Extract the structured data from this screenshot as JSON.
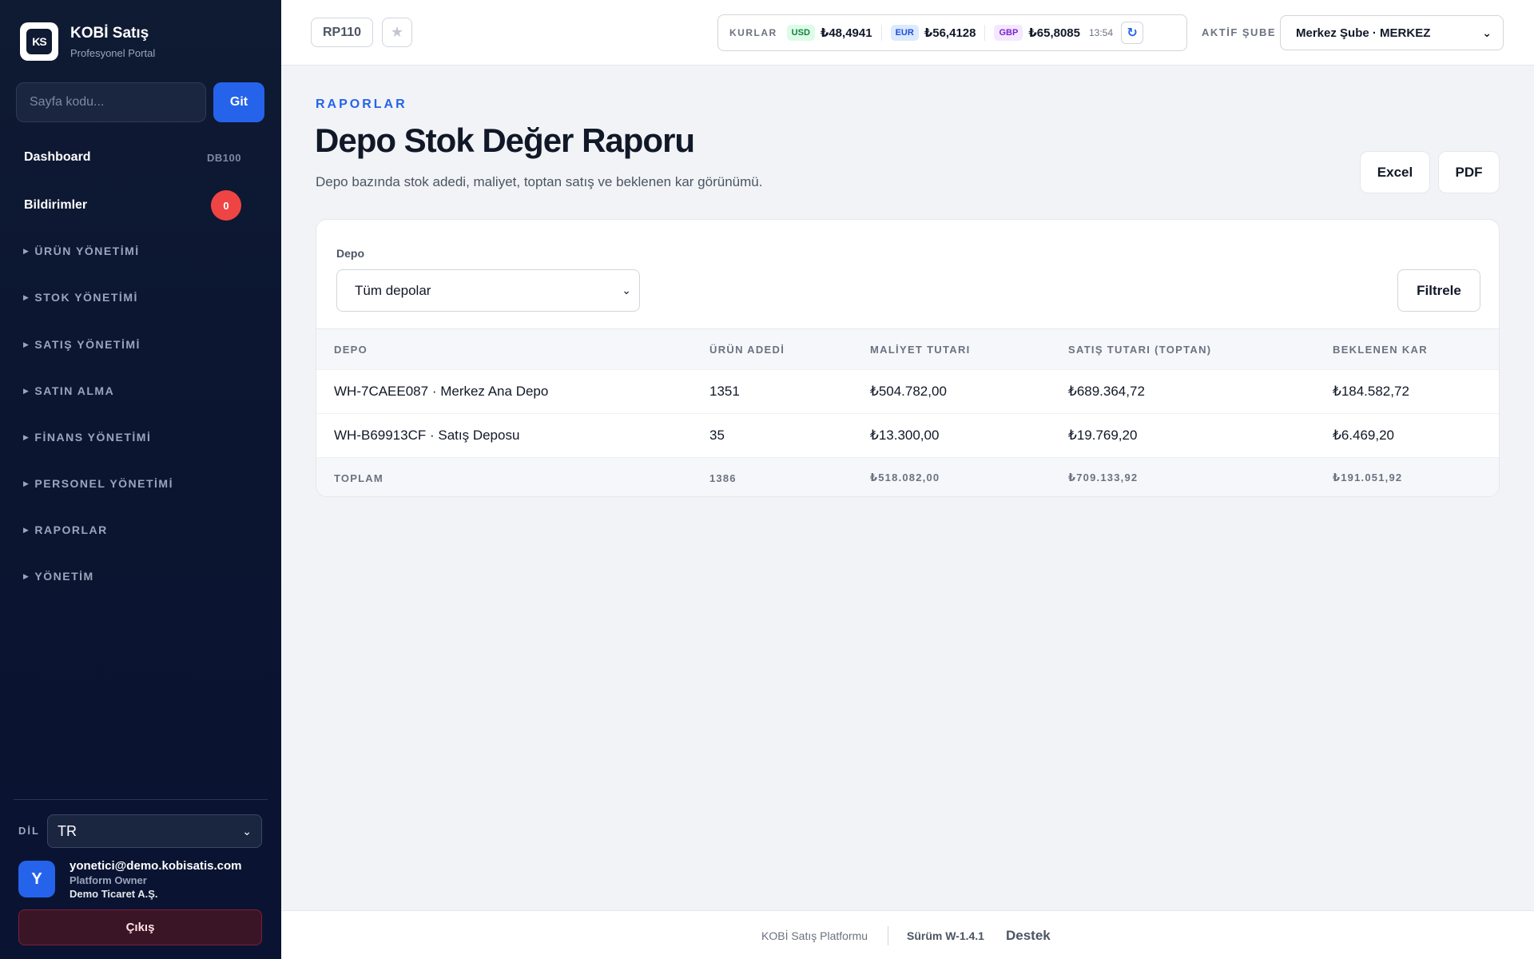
{
  "sidebar": {
    "brand_title": "KOBİ Satış",
    "brand_subtitle": "Profesyonel Portal",
    "logo_text": "KS",
    "search_placeholder": "Sayfa kodu...",
    "go_label": "Git",
    "dashboard_label": "Dashboard",
    "dashboard_code": "DB100",
    "notifications_label": "Bildirimler",
    "notifications_count": "0",
    "groups": [
      "ÜRÜN YÖNETİMİ",
      "STOK YÖNETİMİ",
      "SATIŞ YÖNETİMİ",
      "SATIN ALMA",
      "FİNANS YÖNETİMİ",
      "PERSONEL YÖNETİMİ",
      "RAPORLAR",
      "YÖNETİM"
    ],
    "language_label": "DİL",
    "language_value": "TR",
    "user_initial": "Y",
    "user_email": "yonetici@demo.kobisatis.com",
    "user_role": "Platform Owner",
    "user_company": "Demo Ticaret A.Ş.",
    "logout_label": "Çıkış"
  },
  "topbar": {
    "page_code": "RP110",
    "rates_title": "KURLAR",
    "rates": [
      {
        "code": "USD",
        "value": "₺48,4941",
        "bg": "#dcfce7",
        "fg": "#15803d"
      },
      {
        "code": "EUR",
        "value": "₺56,4128",
        "bg": "#dbeafe",
        "fg": "#1d4ed8"
      },
      {
        "code": "GBP",
        "value": "₺65,8085",
        "bg": "#f3e8ff",
        "fg": "#7e22ce"
      }
    ],
    "rates_time": "13:54",
    "branch_label": "AKTİF ŞUBE",
    "branch_value": "Merkez Şube · MERKEZ"
  },
  "main": {
    "eyebrow": "RAPORLAR",
    "title": "Depo Stok Değer Raporu",
    "description": "Depo bazında stok adedi, maliyet, toptan satış ve beklenen kar görünümü.",
    "excel_label": "Excel",
    "pdf_label": "PDF",
    "filter_label": "Depo",
    "filter_value": "Tüm depolar",
    "filter_button": "Filtrele",
    "table": {
      "headers": [
        "DEPO",
        "ÜRÜN ADEDİ",
        "MALİYET TUTARI",
        "SATIŞ TUTARI (TOPTAN)",
        "BEKLENEN KAR"
      ],
      "rows": [
        [
          "WH-7CAEE087 · Merkez Ana Depo",
          "1351",
          "₺504.782,00",
          "₺689.364,72",
          "₺184.582,72"
        ],
        [
          "WH-B69913CF · Satış Deposu",
          "35",
          "₺13.300,00",
          "₺19.769,20",
          "₺6.469,20"
        ]
      ],
      "footer": [
        "TOPLAM",
        "1386",
        "₺518.082,00",
        "₺709.133,92",
        "₺191.051,92"
      ]
    }
  },
  "footer": {
    "platform": "KOBİ Satış Platformu",
    "version": "Sürüm W-1.4.1",
    "support": "Destek"
  },
  "colors": {
    "accent": "#2563eb",
    "sidebar_bg": "#0f1a33",
    "danger": "#ef4444"
  }
}
